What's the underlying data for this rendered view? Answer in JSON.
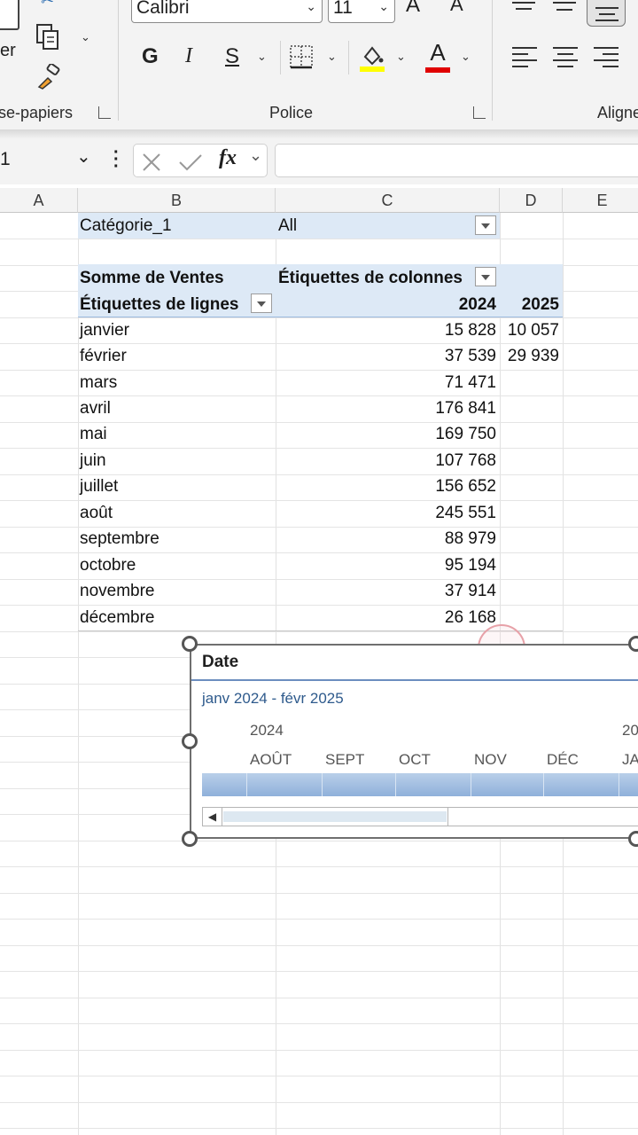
{
  "ribbon": {
    "clipboard_label_partial": "er",
    "clipboard_group_label": "se-papiers",
    "font_name": "Calibri",
    "font_size": "11",
    "grow_font": "A",
    "shrink_font": "A",
    "bold": "G",
    "italic": "I",
    "underline": "S",
    "font_color_letter": "A",
    "font_group_label": "Police",
    "alignment_group_label": "Aligne",
    "highlight_color": "#ffff00",
    "font_color": "#e00000"
  },
  "formula_bar": {
    "name_box": "1",
    "fx": "fx",
    "formula_value": ""
  },
  "columns": [
    "A",
    "B",
    "C",
    "D",
    "E"
  ],
  "pivot": {
    "filter_label": "Catégorie_1",
    "filter_value": "All",
    "values_label": "Somme de Ventes",
    "column_labels": "Étiquettes de colonnes",
    "row_labels": "Étiquettes de lignes",
    "years": [
      "2024",
      "2025"
    ],
    "rows": [
      {
        "label": "janvier",
        "y2024": "15 828",
        "y2025": "10 057"
      },
      {
        "label": "février",
        "y2024": "37 539",
        "y2025": "29 939"
      },
      {
        "label": "mars",
        "y2024": "71 471",
        "y2025": ""
      },
      {
        "label": "avril",
        "y2024": "176 841",
        "y2025": ""
      },
      {
        "label": "mai",
        "y2024": "169 750",
        "y2025": ""
      },
      {
        "label": "juin",
        "y2024": "107 768",
        "y2025": ""
      },
      {
        "label": "juillet",
        "y2024": "156 652",
        "y2025": ""
      },
      {
        "label": "août",
        "y2024": "245 551",
        "y2025": ""
      },
      {
        "label": "septembre",
        "y2024": "88 979",
        "y2025": ""
      },
      {
        "label": "octobre",
        "y2024": "95 194",
        "y2025": ""
      },
      {
        "label": "novembre",
        "y2024": "37 914",
        "y2025": ""
      },
      {
        "label": "décembre",
        "y2024": "26 168",
        "y2025": ""
      }
    ]
  },
  "slicer": {
    "title": "Date",
    "range": "janv 2024 - févr 2025",
    "year_left": "2024",
    "year_right": "20",
    "months": [
      "AOÛT",
      "SEPT",
      "OCT",
      "NOV",
      "DÉC",
      "JAN"
    ],
    "scroll_left_glyph": "◀"
  },
  "colors": {
    "accent": "#2e5a8c",
    "pivot_header_fill": "#dde9f6",
    "slicer_bar": "#9cb9dd"
  }
}
